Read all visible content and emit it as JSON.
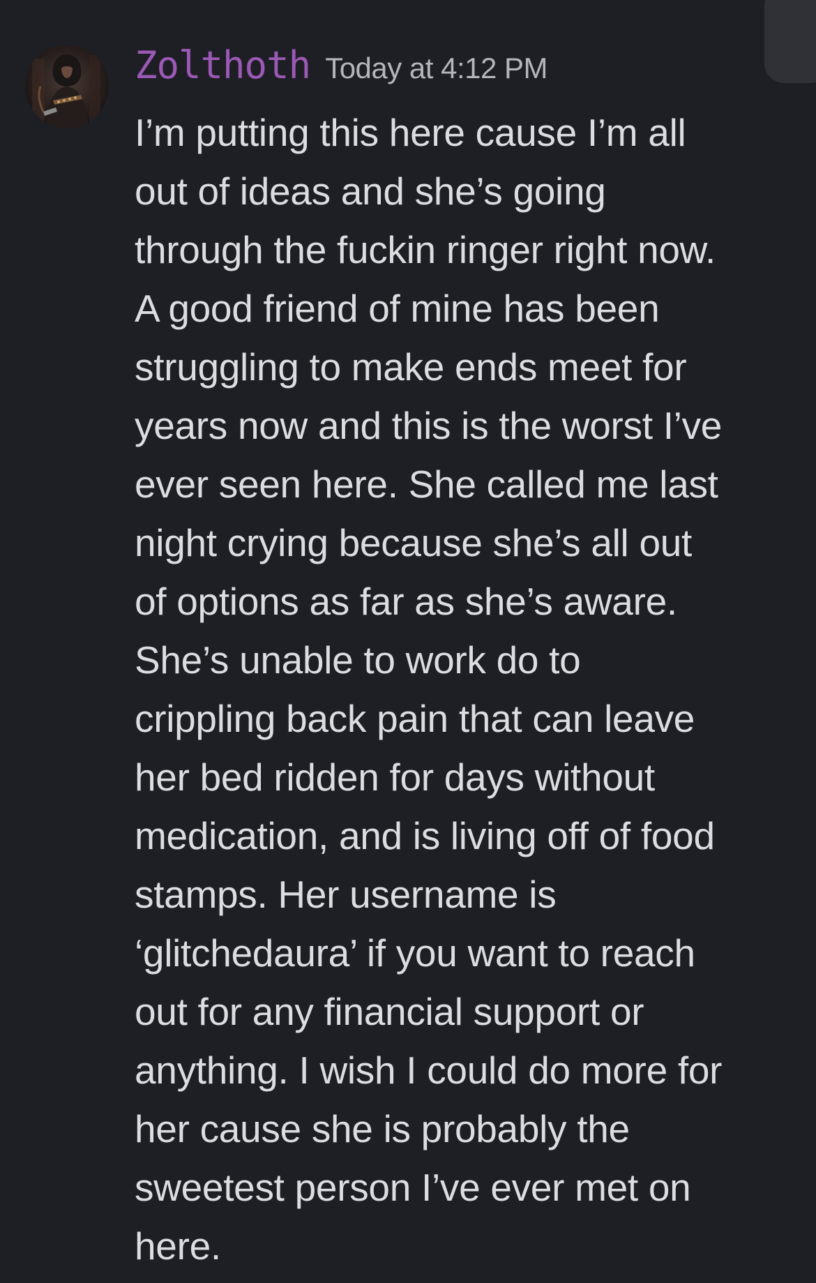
{
  "message": {
    "author": "Zolthoth",
    "timestamp": "Today at 4:12 PM",
    "lines": [
      "I’m putting this here cause I’m all",
      "out of ideas and she’s going",
      "through the fuckin ringer right now.",
      "A good friend of mine has been",
      "struggling to make ends meet for",
      "years now and this is the worst I’ve",
      "ever seen here. She called me last",
      "night crying because she’s all out",
      "of options as far as she’s aware.",
      "She’s unable to work do to",
      "crippling back pain that can leave",
      "her bed ridden for days without",
      "medication, and is living off of food",
      "stamps. Her username is",
      "‘glitchedaura’ if you want to reach",
      "out for any financial support or",
      "anything. I wish I could do more for",
      "her cause she is probably the",
      "sweetest person I’ve ever met on",
      "here."
    ]
  },
  "colors": {
    "background": "#1e1f24",
    "username": "#9b59b6",
    "timestamp": "#b5b6bd",
    "text": "#dcdde1"
  }
}
